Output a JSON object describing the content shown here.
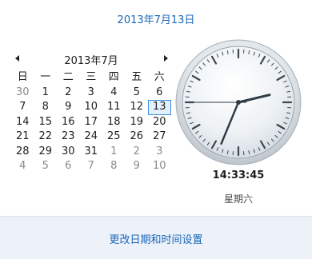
{
  "header": {
    "date": "2013年7月13日"
  },
  "calendar": {
    "month_label": "2013年7月",
    "weekdays": [
      "日",
      "一",
      "二",
      "三",
      "四",
      "五",
      "六"
    ],
    "weeks": [
      [
        {
          "d": "30",
          "m": "other"
        },
        {
          "d": "1",
          "m": "cur"
        },
        {
          "d": "2",
          "m": "cur"
        },
        {
          "d": "3",
          "m": "cur"
        },
        {
          "d": "4",
          "m": "cur"
        },
        {
          "d": "5",
          "m": "cur"
        },
        {
          "d": "6",
          "m": "cur"
        }
      ],
      [
        {
          "d": "7",
          "m": "cur"
        },
        {
          "d": "8",
          "m": "cur"
        },
        {
          "d": "9",
          "m": "cur"
        },
        {
          "d": "10",
          "m": "cur"
        },
        {
          "d": "11",
          "m": "cur"
        },
        {
          "d": "12",
          "m": "cur"
        },
        {
          "d": "13",
          "m": "cur",
          "selected": true
        }
      ],
      [
        {
          "d": "14",
          "m": "cur"
        },
        {
          "d": "15",
          "m": "cur"
        },
        {
          "d": "16",
          "m": "cur"
        },
        {
          "d": "17",
          "m": "cur"
        },
        {
          "d": "18",
          "m": "cur"
        },
        {
          "d": "19",
          "m": "cur"
        },
        {
          "d": "20",
          "m": "cur"
        }
      ],
      [
        {
          "d": "21",
          "m": "cur"
        },
        {
          "d": "22",
          "m": "cur"
        },
        {
          "d": "23",
          "m": "cur"
        },
        {
          "d": "24",
          "m": "cur"
        },
        {
          "d": "25",
          "m": "cur"
        },
        {
          "d": "26",
          "m": "cur"
        },
        {
          "d": "27",
          "m": "cur"
        }
      ],
      [
        {
          "d": "28",
          "m": "cur"
        },
        {
          "d": "29",
          "m": "cur"
        },
        {
          "d": "30",
          "m": "cur"
        },
        {
          "d": "31",
          "m": "cur"
        },
        {
          "d": "1",
          "m": "other"
        },
        {
          "d": "2",
          "m": "other"
        },
        {
          "d": "3",
          "m": "other"
        }
      ],
      [
        {
          "d": "4",
          "m": "other"
        },
        {
          "d": "5",
          "m": "other"
        },
        {
          "d": "6",
          "m": "other"
        },
        {
          "d": "7",
          "m": "other"
        },
        {
          "d": "8",
          "m": "other"
        },
        {
          "d": "9",
          "m": "other"
        },
        {
          "d": "10",
          "m": "other"
        }
      ]
    ],
    "prev_icon": "chevron-left-icon",
    "next_icon": "chevron-right-icon"
  },
  "clock": {
    "time": "14:33:45",
    "weekday": "星期六",
    "hour": 14,
    "minute": 33,
    "second": 45
  },
  "footer": {
    "link": "更改日期和时间设置"
  },
  "colors": {
    "link": "#1a67b8",
    "selected_border": "#3b8ee0",
    "footer_bg": "#edf2f9"
  }
}
